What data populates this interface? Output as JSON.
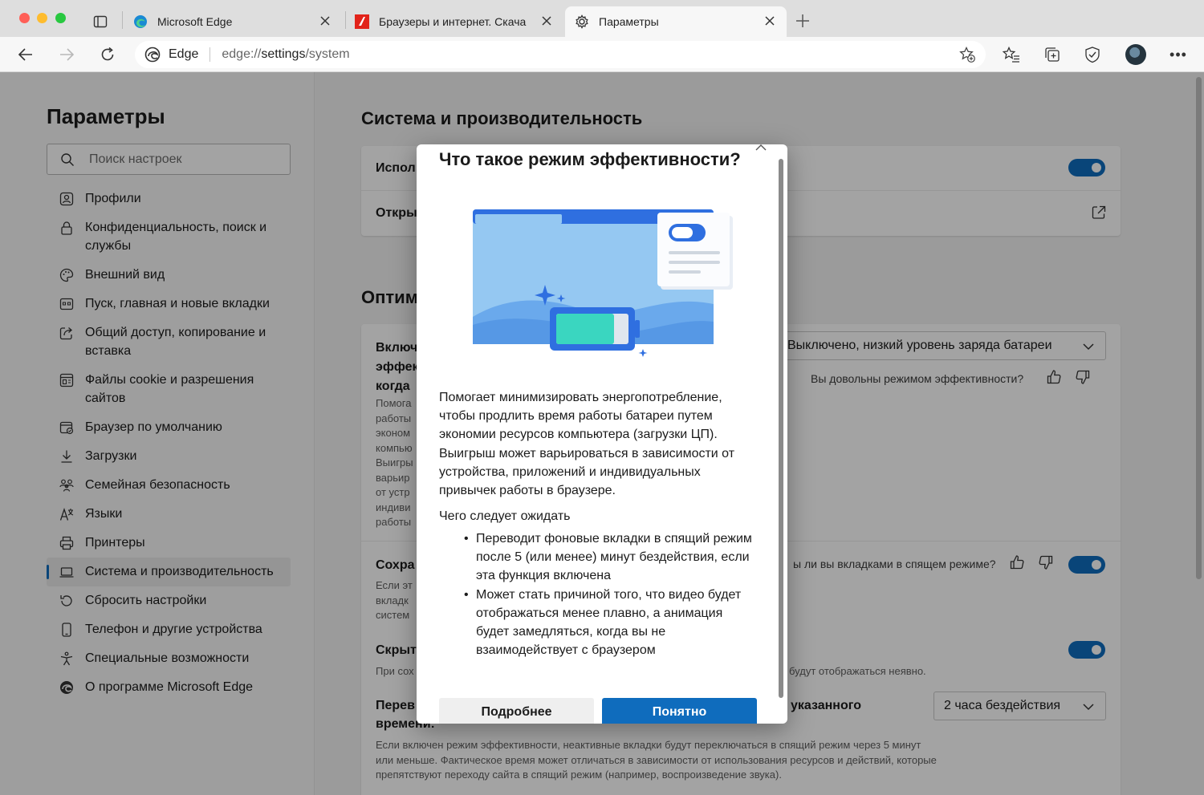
{
  "tabs": [
    {
      "title": "Microsoft Edge",
      "icon": "edge-logo-icon",
      "active": false
    },
    {
      "title": "Браузеры и интернет. Скача",
      "icon": "site-favicon-icon",
      "active": false
    },
    {
      "title": "Параметры",
      "icon": "gear-icon",
      "active": true
    }
  ],
  "address": {
    "brand": "Edge",
    "url_prefix": "edge://",
    "url_main": "settings",
    "url_suffix": "/system"
  },
  "sidebar": {
    "title": "Параметры",
    "search_placeholder": "Поиск настроек",
    "items": [
      {
        "label": "Профили",
        "icon": "profile-icon"
      },
      {
        "label": "Конфиденциальность, поиск и службы",
        "icon": "lock-icon"
      },
      {
        "label": "Внешний вид",
        "icon": "palette-icon"
      },
      {
        "label": "Пуск, главная и новые вкладки",
        "icon": "home-tabs-icon"
      },
      {
        "label": "Общий доступ, копирование и вставка",
        "icon": "share-icon"
      },
      {
        "label": "Файлы cookie и разрешения сайтов",
        "icon": "cookie-icon"
      },
      {
        "label": "Браузер по умолчанию",
        "icon": "default-browser-icon"
      },
      {
        "label": "Загрузки",
        "icon": "download-icon"
      },
      {
        "label": "Семейная безопасность",
        "icon": "family-icon"
      },
      {
        "label": "Языки",
        "icon": "language-icon"
      },
      {
        "label": "Принтеры",
        "icon": "printer-icon"
      },
      {
        "label": "Система и производительность",
        "icon": "laptop-icon",
        "selected": true
      },
      {
        "label": "Сбросить настройки",
        "icon": "reset-icon"
      },
      {
        "label": "Телефон и другие устройства",
        "icon": "phone-icon"
      },
      {
        "label": "Специальные возможности",
        "icon": "accessibility-icon"
      },
      {
        "label": "О программе Microsoft Edge",
        "icon": "edge-logo-icon"
      }
    ]
  },
  "main": {
    "heading": "Система и производительность",
    "row1_label": "Испол",
    "row2_label": "Откры",
    "section2_heading": "Оптим",
    "efficiency": {
      "label": "Включ\nэффек\nкогда",
      "desc": "Помога\nработы\nэконом\nкомпью\nВыигры\nварьир\nот устр\nиндиви\nработы",
      "select_value": "Выключено, низкий уровень заряда батареи",
      "feedback": "Вы довольны режимом эффективности?"
    },
    "save": {
      "label": "Сохра",
      "desc": "Если эт\nвкладк\nсистем",
      "feedback": "ы ли вы вкладками в спящем режиме?"
    },
    "hide": {
      "label": "Скрыт",
      "desc_left": "При сох",
      "desc_right": "будут отображаться неявно."
    },
    "sleep": {
      "label_left": "Перев",
      "label_right": "указанного",
      "label_line2": "времени:",
      "select_value": "2 часа бездействия",
      "desc": "Если включен режим эффективности, неактивные вкладки будут переключаться в спящий режим через 5 минут или меньше. Фактическое время может отличаться в зависимости от использования ресурсов и действий, которые препятствуют переходу сайта в спящий режим (например, воспроизведение звука)."
    }
  },
  "dialog": {
    "title": "Что такое режим эффективности?",
    "body": "Помогает минимизировать энергопотребление, чтобы продлить время работы батареи путем экономии ресурсов компьютера (загрузки ЦП). Выигрыш может варьироваться в зависимости от устройства, приложений и индивидуальных привычек работы в браузере.",
    "expect_heading": "Чего следует ожидать",
    "expect_items": [
      "Переводит фоновые вкладки в спящий режим после 5 (или менее) минут бездействия, если эта функция включена",
      "Может стать причиной того, что видео будет отображаться менее плавно, а анимация будет замедляться, когда вы не взаимодействует с браузером"
    ],
    "btn_more": "Подробнее",
    "btn_ok": "Понятно"
  },
  "colors": {
    "accent": "#0f6cbd",
    "overlay": "rgba(0,0,0,0.36)"
  }
}
